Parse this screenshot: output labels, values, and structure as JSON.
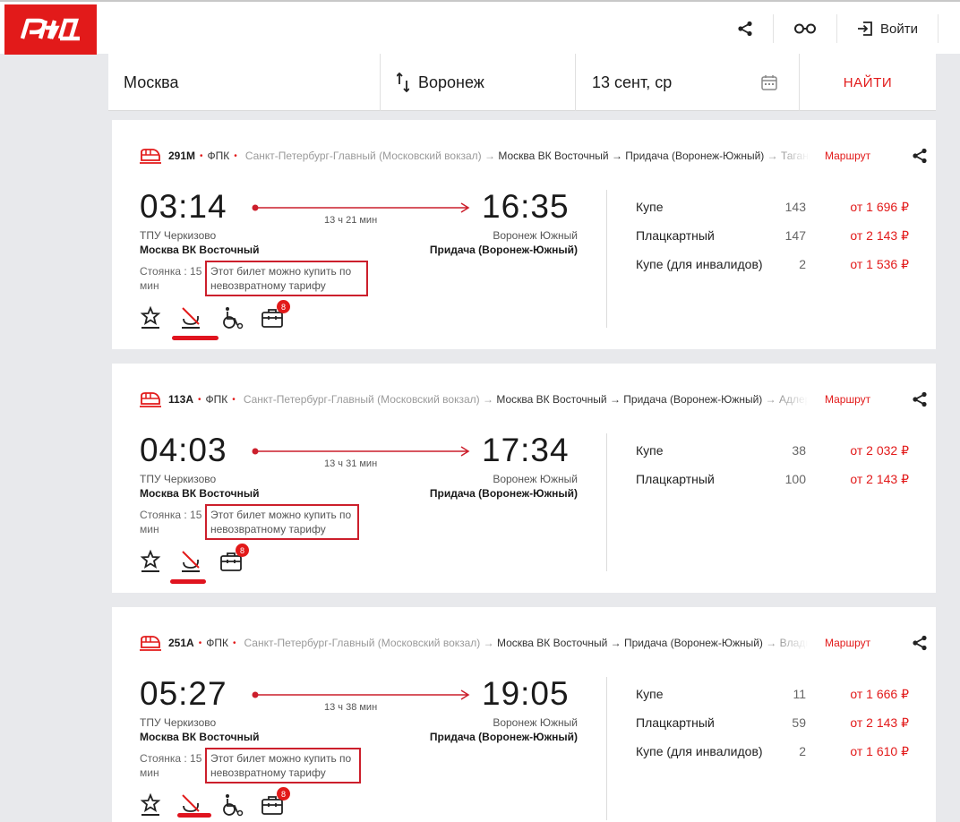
{
  "header": {
    "logo_text": "РЖД",
    "login_label": "Войти",
    "colors": {
      "brand_red": "#e21a1a"
    }
  },
  "search": {
    "from": "Москва",
    "to": "Воронеж",
    "date": "13 сент, ср",
    "find_label": "НАЙТИ"
  },
  "trains": [
    {
      "number": "291М",
      "carrier": "ФПК",
      "route_grey_start": "Санкт-Петербург-Главный (Московский вокзал) →",
      "route_main": "Москва ВК Восточный → Придача (Воронеж-Южный)",
      "route_grey_end": "→ Таганрог",
      "route_link": "Маршрут",
      "dep_time": "03:14",
      "arr_time": "16:35",
      "duration": "13 ч 21 мин",
      "dep_station_small": "ТПУ Черкизово",
      "dep_station": "Москва ВК Восточный",
      "arr_station_small": "Воронеж Южный",
      "arr_station": "Придача (Воронеж-Южный)",
      "stop": "Стоянка : 15 мин",
      "nonrefund": "Этот билет можно купить по невозвратному тарифу",
      "badge": "8",
      "fares": [
        {
          "class": "Купе",
          "seats": "143",
          "price": "от 1 696 ₽"
        },
        {
          "class": "Плацкартный",
          "seats": "147",
          "price": "от 2 143 ₽"
        },
        {
          "class": "Купе (для инвалидов)",
          "seats": "2",
          "price": "от 1 536 ₽"
        }
      ]
    },
    {
      "number": "113А",
      "carrier": "ФПК",
      "route_grey_start": "Санкт-Петербург-Главный (Московский вокзал) →",
      "route_main": "Москва ВК Восточный → Придача (Воронеж-Южный)",
      "route_grey_end": "→ Адлер",
      "route_link": "Маршрут",
      "dep_time": "04:03",
      "arr_time": "17:34",
      "duration": "13 ч 31 мин",
      "dep_station_small": "ТПУ Черкизово",
      "dep_station": "Москва ВК Восточный",
      "arr_station_small": "Воронеж Южный",
      "arr_station": "Придача (Воронеж-Южный)",
      "stop": "Стоянка : 15 мин",
      "nonrefund": "Этот билет можно купить по невозвратному тарифу",
      "badge": "8",
      "fares": [
        {
          "class": "Купе",
          "seats": "38",
          "price": "от 2 032 ₽"
        },
        {
          "class": "Плацкартный",
          "seats": "100",
          "price": "от 2 143 ₽"
        }
      ]
    },
    {
      "number": "251А",
      "carrier": "ФПК",
      "route_grey_start": "Санкт-Петербург-Главный (Московский вокзал) →",
      "route_main": "Москва ВК Восточный → Придача (Воронеж-Южный)",
      "route_grey_end": "→ Владикавказ",
      "route_link": "Маршрут",
      "dep_time": "05:27",
      "arr_time": "19:05",
      "duration": "13 ч 38 мин",
      "dep_station_small": "ТПУ Черкизово",
      "dep_station": "Москва ВК Восточный",
      "arr_station_small": "Воронеж Южный",
      "arr_station": "Придача (Воронеж-Южный)",
      "stop": "Стоянка : 15 мин",
      "nonrefund": "Этот билет можно купить по невозвратному тарифу",
      "badge": "8",
      "fares": [
        {
          "class": "Купе",
          "seats": "11",
          "price": "от 1 666 ₽"
        },
        {
          "class": "Плацкартный",
          "seats": "59",
          "price": "от 2 143 ₽"
        },
        {
          "class": "Купе (для инвалидов)",
          "seats": "2",
          "price": "от 1 610 ₽"
        }
      ]
    }
  ]
}
